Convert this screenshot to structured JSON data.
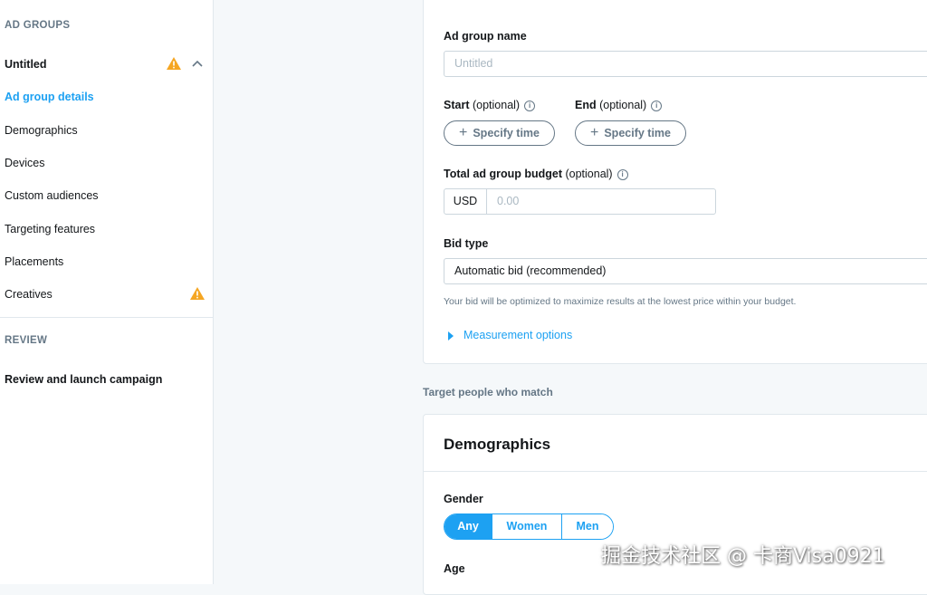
{
  "sidebar": {
    "ad_groups_heading": "AD GROUPS",
    "group_name": "Untitled",
    "items": [
      {
        "label": "Ad group details",
        "active": true
      },
      {
        "label": "Demographics"
      },
      {
        "label": "Devices"
      },
      {
        "label": "Custom audiences"
      },
      {
        "label": "Targeting features"
      },
      {
        "label": "Placements"
      },
      {
        "label": "Creatives",
        "warning": true
      }
    ],
    "review_heading": "REVIEW",
    "review_item": "Review and launch campaign"
  },
  "details": {
    "name_label": "Ad group name",
    "name_placeholder": "Untitled",
    "start_label": "Start",
    "end_label": "End",
    "optional": "(optional)",
    "specify_time": "Specify time",
    "budget_label": "Total ad group budget",
    "currency": "USD",
    "budget_placeholder": "0.00",
    "bid_type_label": "Bid type",
    "bid_type_value": "Automatic bid (recommended)",
    "bid_help": "Your bid will be optimized to maximize results at the lowest price within your budget.",
    "measurement_link": "Measurement options"
  },
  "target_heading": "Target people who match",
  "demographics": {
    "title": "Demographics",
    "gender_label": "Gender",
    "gender_options": [
      "Any",
      "Women",
      "Men"
    ],
    "gender_selected": "Any",
    "age_label": "Age"
  },
  "watermark": "掘金技术社区 @ 卡商Visa0921",
  "colors": {
    "accent": "#1da1f2",
    "warning": "#f5a623",
    "muted": "#657786",
    "border": "#e1e8ed"
  },
  "icons": {
    "warning": "warning-icon",
    "collapse": "chevron-up-icon",
    "info": "info-icon",
    "expand": "caret-right-icon"
  }
}
